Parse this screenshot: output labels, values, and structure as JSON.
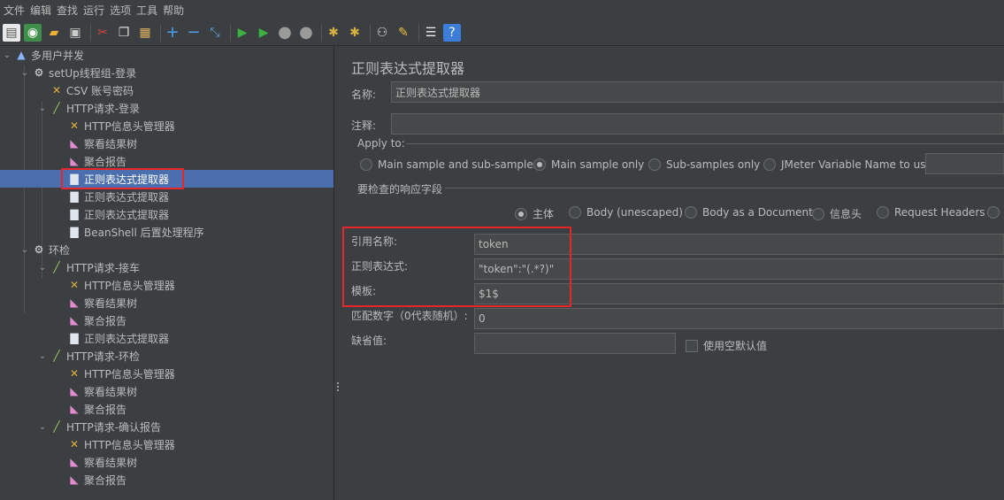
{
  "menu": [
    "文件",
    "编辑",
    "查找",
    "运行",
    "选项",
    "工具",
    "帮助"
  ],
  "toolbar_icons": [
    "new-icon",
    "templates-icon",
    "open-icon",
    "save-icon",
    "cut-icon",
    "copy-icon",
    "paste-icon",
    "expand-icon",
    "collapse-icon",
    "toggle-icon",
    "start-icon",
    "start-no-pause-icon",
    "stop-icon",
    "shutdown-icon",
    "clear-icon",
    "clear-all-icon",
    "search-icon",
    "reset-search-icon",
    "function-helper-icon",
    "help-icon"
  ],
  "tree": {
    "items": [
      {
        "label": "多用户并发",
        "icon": "test-plan-icon"
      },
      {
        "label": "setUp线程组-登录",
        "icon": "gear-icon"
      },
      {
        "label": "CSV 账号密码",
        "icon": "config-element-icon"
      },
      {
        "label": "HTTP请求-登录",
        "icon": "sampler-icon"
      },
      {
        "label": "HTTP信息头管理器",
        "icon": "config-element-icon"
      },
      {
        "label": "察看结果树",
        "icon": "listener-icon"
      },
      {
        "label": "聚合报告",
        "icon": "listener-icon"
      },
      {
        "label": "正则表达式提取器",
        "icon": "post-processor-icon"
      },
      {
        "label": "正则表达式提取器",
        "icon": "post-processor-icon"
      },
      {
        "label": "正则表达式提取器",
        "icon": "post-processor-icon"
      },
      {
        "label": "BeanShell 后置处理程序",
        "icon": "post-processor-icon"
      },
      {
        "label": "环检",
        "icon": "gear-icon"
      },
      {
        "label": "HTTP请求-接车",
        "icon": "sampler-icon"
      },
      {
        "label": "HTTP信息头管理器",
        "icon": "config-element-icon"
      },
      {
        "label": "察看结果树",
        "icon": "listener-icon"
      },
      {
        "label": "聚合报告",
        "icon": "listener-icon"
      },
      {
        "label": "正则表达式提取器",
        "icon": "post-processor-icon"
      },
      {
        "label": "HTTP请求-环检",
        "icon": "sampler-icon"
      },
      {
        "label": "HTTP信息头管理器",
        "icon": "config-element-icon"
      },
      {
        "label": "察看结果树",
        "icon": "listener-icon"
      },
      {
        "label": "聚合报告",
        "icon": "listener-icon"
      },
      {
        "label": "HTTP请求-确认报告",
        "icon": "sampler-icon"
      },
      {
        "label": "HTTP信息头管理器",
        "icon": "config-element-icon"
      },
      {
        "label": "察看结果树",
        "icon": "listener-icon"
      },
      {
        "label": "聚合报告",
        "icon": "listener-icon"
      }
    ]
  },
  "panel": {
    "title": "正则表达式提取器",
    "name_label": "名称:",
    "name_value": "正则表达式提取器",
    "comment_label": "注释:",
    "comment_value": "",
    "apply_to_label": "Apply to:",
    "apply_options": [
      "Main sample and sub-samples",
      "Main sample only",
      "Sub-samples only",
      "JMeter Variable Name to use"
    ],
    "apply_selected": "Main sample only",
    "jmeter_var_value": "",
    "response_field_label": "要检查的响应字段",
    "response_options": [
      "主体",
      "Body (unescaped)",
      "Body as a Document",
      "信息头",
      "Request Headers"
    ],
    "response_selected": "主体",
    "ref_name_label": "引用名称:",
    "ref_name_value": "token",
    "regex_label": "正则表达式:",
    "regex_value": "\"token\":\"(.*?)\"",
    "template_label": "模板:",
    "template_value": "$1$",
    "match_no_label": "匹配数字（0代表随机）:",
    "match_no_value": "0",
    "default_label": "缺省值:",
    "default_value": "",
    "empty_default_label": "使用空默认值"
  },
  "colors": {
    "background": "#3c3f41",
    "selection": "#4b6eaf",
    "highlight_border": "#e8262a",
    "text": "#bbbbbb"
  }
}
